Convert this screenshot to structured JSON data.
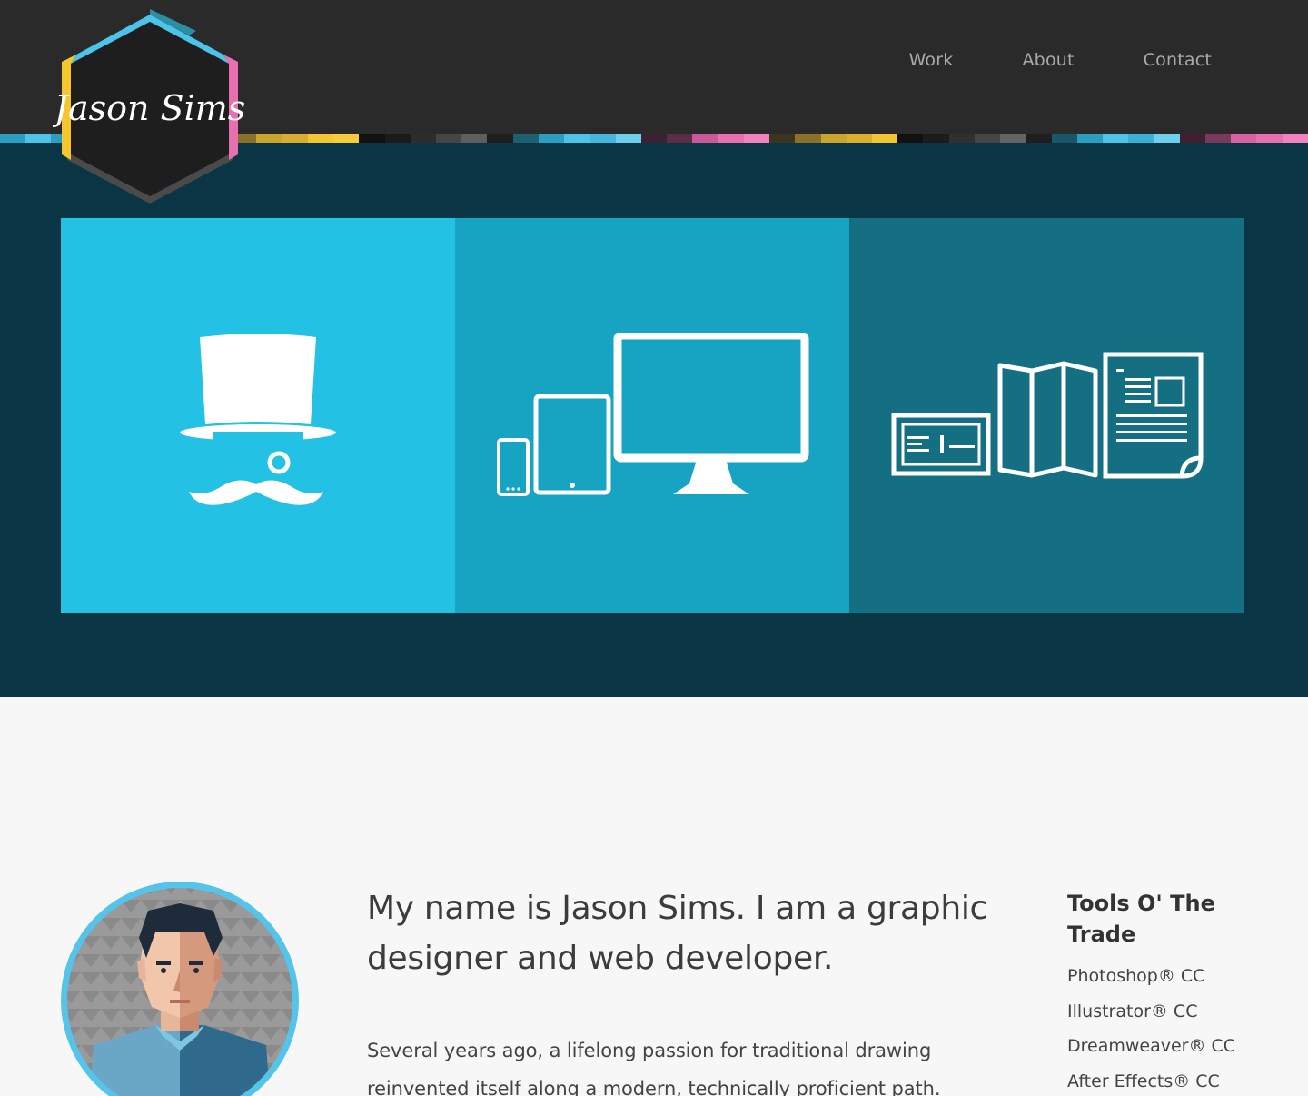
{
  "logo": {
    "text": "Jason Sims",
    "colors": {
      "cyan": "#4cc3e8",
      "teal": "#2a8fa5",
      "magenta": "#e86fb0",
      "yellow": "#f6c630",
      "black": "#1e1e1e",
      "gray": "#4a4a4a"
    }
  },
  "nav": {
    "items": [
      {
        "label": "Work"
      },
      {
        "label": "About"
      },
      {
        "label": "Contact"
      }
    ]
  },
  "hero": {
    "panels": [
      {
        "icon": "top-hat-monocle-mustache-icon",
        "color": "#23c1e3"
      },
      {
        "icon": "responsive-devices-icon",
        "color": "#17a4c2"
      },
      {
        "icon": "print-collateral-icon",
        "color": "#146f82"
      }
    ]
  },
  "about": {
    "headline": "My name is Jason Sims. I am a graphic designer and web developer.",
    "bio": "Several years ago, a lifelong passion for traditional drawing reinvented itself along a modern, technically proficient path.",
    "tools": {
      "title": "Tools O' The Trade",
      "items": [
        "Photoshop® CC",
        "Illustrator® CC",
        "Dreamweaver® CC",
        "After Effects® CC"
      ]
    }
  },
  "colors": {
    "header": "#2a2a2a",
    "hero_bg": "#093545",
    "stripe": [
      "#2a9fc0",
      "#4cc3e8",
      "#2a9fc0",
      "#4cc3e8",
      "#6ecfec",
      "#2a9fc0",
      "#4cc3e8",
      "#1e6f85",
      "#3a3a3a",
      "#8a7028",
      "#c9a52c",
      "#d9ae2e",
      "#f4c533",
      "#f6cc3a",
      "#111111",
      "#1b1b1b",
      "#2d2d2d",
      "#454545",
      "#5e5e5e",
      "#1e1e1e",
      "#1f5f72",
      "#2a9fc0",
      "#4cc3e8",
      "#43b7dc",
      "#6ecfec",
      "#3a2230",
      "#5a2e45",
      "#c95a99",
      "#e86fb0",
      "#f282be",
      "#3b3520",
      "#8a7028",
      "#c9a52c",
      "#dcb02e",
      "#f4c533",
      "#111111",
      "#1c1c1c",
      "#303030",
      "#454545",
      "#636363",
      "#1e1e1e",
      "#1a5669",
      "#2a9fc0",
      "#4cc3e8",
      "#3ab0d6",
      "#6ecfec",
      "#40202e",
      "#7a3a5c",
      "#d962a5",
      "#e86fb0",
      "#f282be"
    ]
  }
}
